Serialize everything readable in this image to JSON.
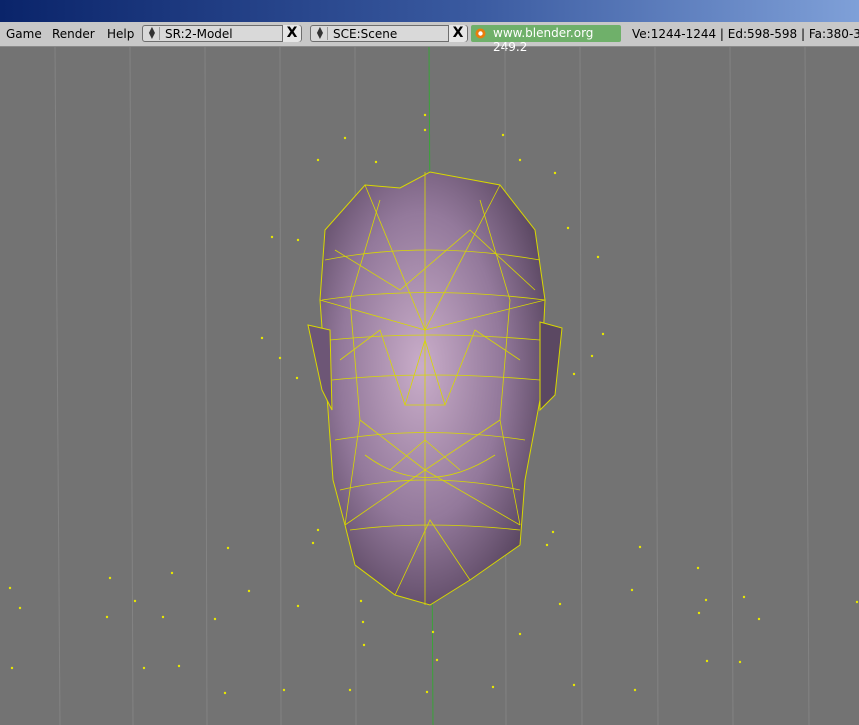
{
  "menu": {
    "game": "Game",
    "render": "Render",
    "help": "Help"
  },
  "screen_selector": {
    "value": "SR:2-Model",
    "close": "X"
  },
  "scene_selector": {
    "value": "SCE:Scene",
    "close": "X"
  },
  "website": "www.blender.org 249.2",
  "stats": "Ve:1244-1244 | Ed:598-598 | Fa:380-3",
  "colors": {
    "viewport_bg": "#737373",
    "mesh": "#e6e600",
    "skin": "#8e7696",
    "url_bg": "#6fb06a"
  }
}
